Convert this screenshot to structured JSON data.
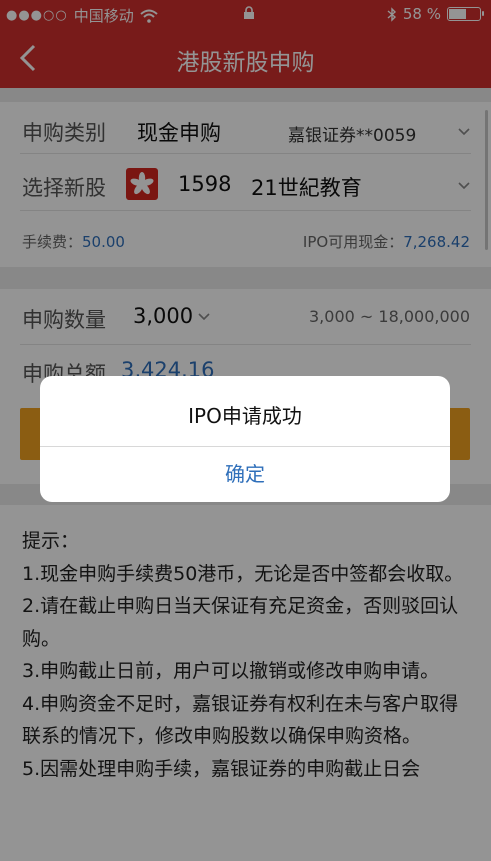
{
  "status_bar": {
    "carrier": "中国移动",
    "battery": "58 %",
    "battery_level": 0.58
  },
  "nav": {
    "title": "港股新股申购"
  },
  "form": {
    "type_label": "申购类别",
    "type_value": "现金申购",
    "account": "嘉银证券**0059",
    "stock_label": "选择新股",
    "stock_code": "1598",
    "stock_name": "21世紀教育",
    "fee_label": "手续费：",
    "fee_value": "50.00",
    "cash_label": "IPO可用现金：",
    "cash_value": "7,268.42",
    "qty_label": "申购数量",
    "qty_value": "3,000",
    "qty_range": "3,000 ~ 18,000,000",
    "total_label": "申购总额",
    "total_value": "3,424.16"
  },
  "tips": {
    "title": "提示：",
    "items": [
      "1.现金申购手续费50港币，无论是否中签都会收取。",
      "2.请在截止申购日当天保证有充足资金，否则驳回认购。",
      "3.申购截止日前，用户可以撤销或修改申购申请。",
      "4.申购资金不足时，嘉银证券有权利在未与客户取得联系的情况下，修改申购股数以确保申购资格。",
      "5.因需处理申购手续，嘉银证券的申购截止日会"
    ]
  },
  "dialog": {
    "message": "IPO申请成功",
    "confirm": "确定"
  },
  "colors": {
    "brand_red": "#cf2f2d",
    "link_blue": "#2f6fba",
    "button_orange": "#f0a020"
  }
}
